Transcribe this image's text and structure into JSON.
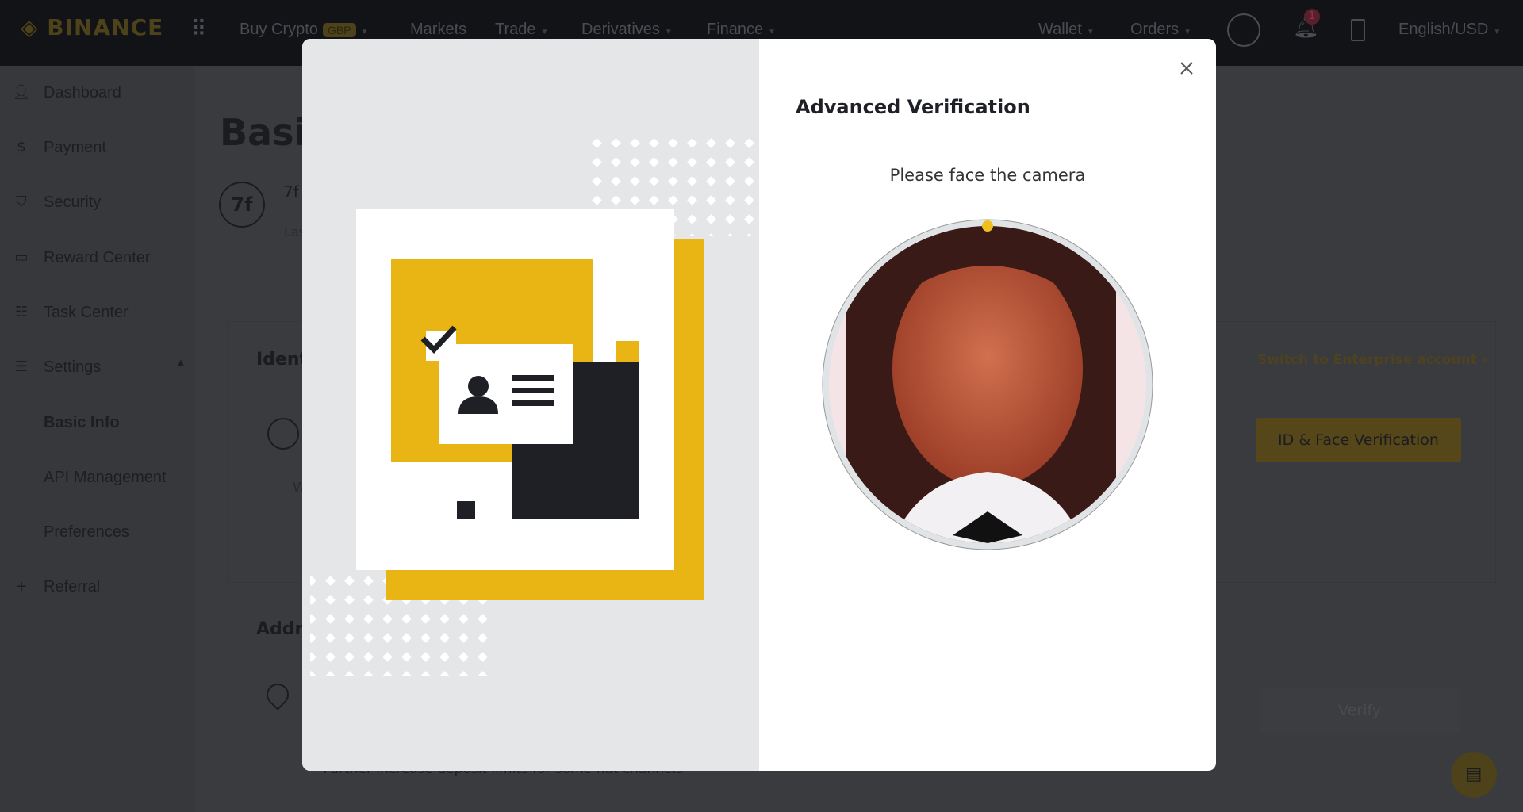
{
  "header": {
    "logo": "BINANCE",
    "nav": [
      {
        "label": "Buy Crypto",
        "badge": "GBP"
      },
      {
        "label": "Markets"
      },
      {
        "label": "Trade"
      },
      {
        "label": "Derivatives"
      },
      {
        "label": "Finance"
      }
    ],
    "right": {
      "wallet": "Wallet",
      "orders": "Orders",
      "notifications_count": "1",
      "language": "English/USD"
    }
  },
  "sidebar": {
    "items": [
      {
        "label": "Dashboard",
        "icon": "user-icon"
      },
      {
        "label": "Payment",
        "icon": "dollar-icon"
      },
      {
        "label": "Security",
        "icon": "shield-icon"
      },
      {
        "label": "Reward Center",
        "icon": "ticket-icon"
      },
      {
        "label": "Task Center",
        "icon": "clipboard-icon"
      },
      {
        "label": "Settings",
        "icon": "sliders-icon"
      },
      {
        "label": "Basic Info"
      },
      {
        "label": "API Management"
      },
      {
        "label": "Preferences"
      },
      {
        "label": "Referral",
        "icon": "user-plus-icon"
      }
    ]
  },
  "main": {
    "title": "Basic",
    "avatar": "7f",
    "user_prefix": "7f",
    "last_prefix": "Las",
    "identity_heading": "Ident",
    "address_heading": "Addre",
    "list_prefix": "W",
    "switch_link": "Switch to Enterprise account",
    "id_face_button": "ID & Face Verification",
    "verify_button": "Verify",
    "bottom_text": "Further increase deposit limits for some fiat channels"
  },
  "modal": {
    "title": "Advanced Verification",
    "prompt": "Please face the camera",
    "camera_feed": "user face"
  },
  "colors": {
    "accent": "#f0b90b",
    "illustration_yellow": "#e8b514",
    "dark": "#1e2026"
  }
}
